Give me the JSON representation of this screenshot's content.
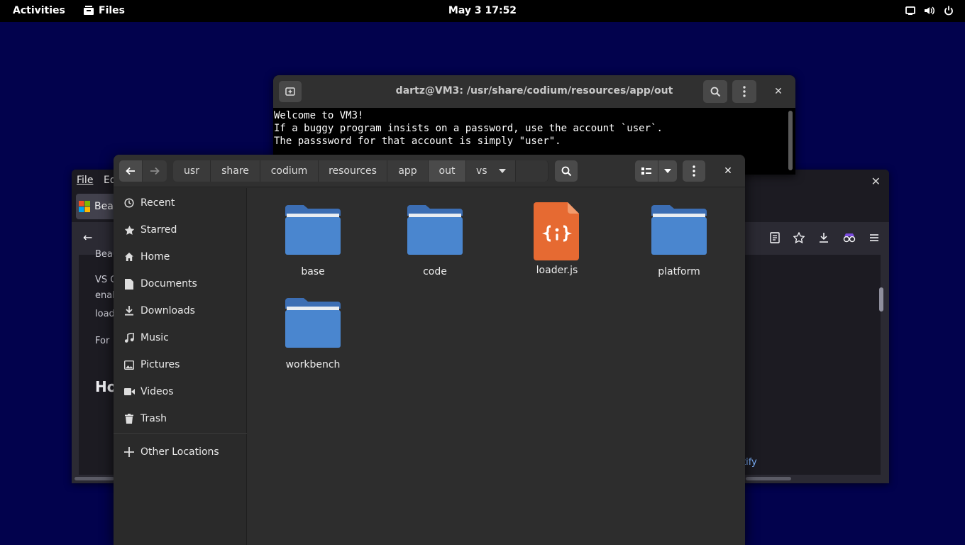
{
  "topbar": {
    "activities": "Activities",
    "app_name": "Files",
    "clock": "May 3  17:52",
    "tray_icons": [
      "screen-icon",
      "volume-icon",
      "power-icon"
    ]
  },
  "browser": {
    "menu": [
      "File",
      "Ed"
    ],
    "tab_label": "Bea",
    "text_lines": [
      "Beau",
      "VS C",
      "enab",
      "load",
      "For"
    ],
    "heading": "Ho",
    "link_fragment": "tify"
  },
  "terminal": {
    "title": "dartz@VM3: /usr/share/codium/resources/app/out",
    "lines": [
      "Welcome to VM3!",
      "If a buggy program insists on a password, use the account `user`.",
      "The passsword for that account is simply \"user\"."
    ]
  },
  "files": {
    "breadcrumbs": [
      "usr",
      "share",
      "codium",
      "resources",
      "app",
      "out",
      "vs"
    ],
    "sidebar": [
      {
        "label": "Recent",
        "icon": "clock-icon"
      },
      {
        "label": "Starred",
        "icon": "star-icon"
      },
      {
        "label": "Home",
        "icon": "home-icon"
      },
      {
        "label": "Documents",
        "icon": "document-icon"
      },
      {
        "label": "Downloads",
        "icon": "download-icon"
      },
      {
        "label": "Music",
        "icon": "music-icon"
      },
      {
        "label": "Pictures",
        "icon": "picture-icon"
      },
      {
        "label": "Videos",
        "icon": "video-icon"
      },
      {
        "label": "Trash",
        "icon": "trash-icon"
      },
      {
        "label": "Other Locations",
        "icon": "plus-icon"
      }
    ],
    "items": [
      {
        "name": "base",
        "type": "folder"
      },
      {
        "name": "code",
        "type": "folder"
      },
      {
        "name": "loader.js",
        "type": "javascript-file"
      },
      {
        "name": "platform",
        "type": "folder"
      },
      {
        "name": "workbench",
        "type": "folder"
      }
    ]
  },
  "colors": {
    "desktop": "#02024d",
    "folder": "#4a86cf",
    "js_file": "#e66a32"
  }
}
